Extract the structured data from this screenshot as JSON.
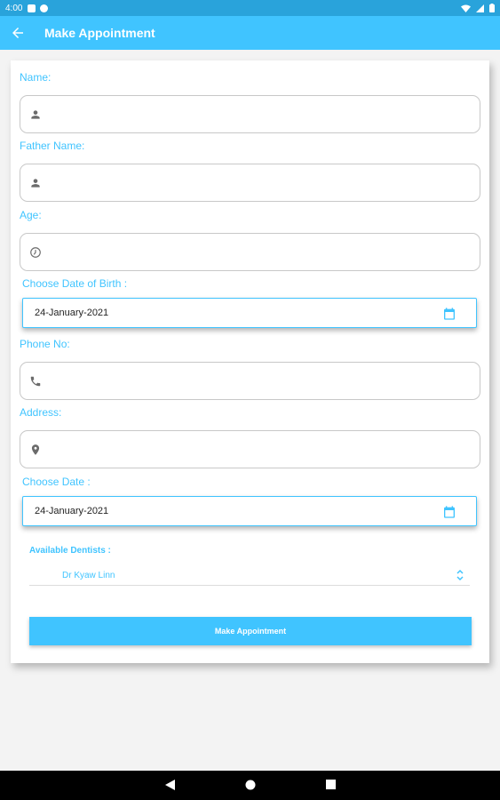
{
  "status_bar": {
    "time": "4:00"
  },
  "app_bar": {
    "title": "Make Appointment"
  },
  "form": {
    "name_label": "Name:",
    "father_name_label": "Father Name:",
    "age_label": "Age:",
    "dob_label": "Choose Date of Birth :",
    "dob_value": "24-January-2021",
    "phone_label": "Phone No:",
    "address_label": "Address:",
    "date_label": "Choose Date :",
    "date_value": "24-January-2021",
    "dentists_label": "Available Dentists :",
    "dentist_selected": "Dr Kyaw Linn",
    "submit_label": "Make Appointment"
  },
  "colors": {
    "accent": "#40c4ff",
    "status_bar": "#29a3db",
    "icon_gray": "#6b6b6b"
  }
}
